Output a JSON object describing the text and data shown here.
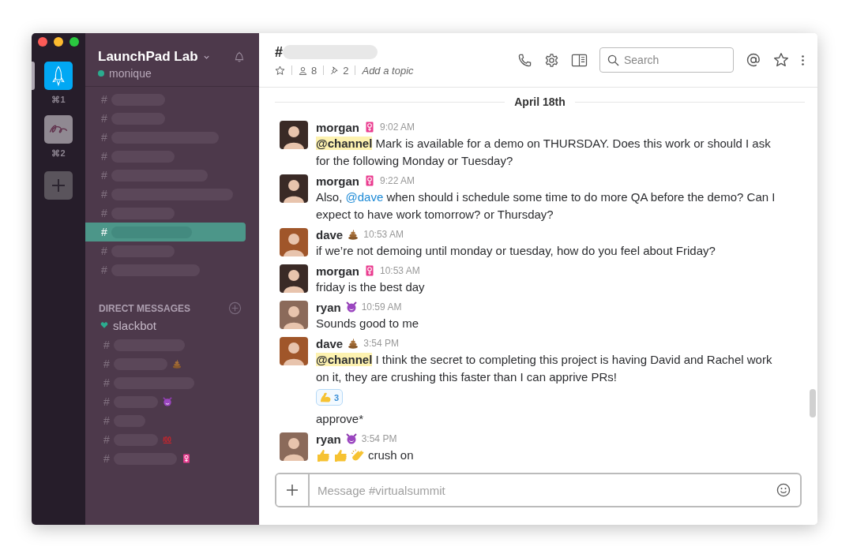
{
  "teams": [
    {
      "kind": "rocket",
      "shortcut": "⌘1",
      "selected": true
    },
    {
      "kind": "sass",
      "shortcut": "⌘2",
      "selected": false
    }
  ],
  "sidebar": {
    "team_name": "LaunchPad Lab",
    "user": "monique",
    "channels": [
      {
        "prefix": "#",
        "selected": false
      },
      {
        "prefix": "#",
        "selected": false
      },
      {
        "prefix": "#",
        "selected": false
      },
      {
        "prefix": "#",
        "selected": false
      },
      {
        "prefix": "#",
        "selected": false
      },
      {
        "prefix": "#",
        "selected": false
      },
      {
        "prefix": "#",
        "selected": false
      },
      {
        "prefix": "#",
        "selected": true
      },
      {
        "prefix": "#",
        "selected": false
      },
      {
        "prefix": "#",
        "selected": false
      }
    ],
    "direct_messages_heading": "DIRECT MESSAGES",
    "direct_messages": [
      {
        "kind": "bot",
        "name": "slackbot"
      },
      {
        "kind": "redacted",
        "prefix": "#"
      },
      {
        "kind": "redacted",
        "prefix": "#",
        "status": {
          "kind": "poop"
        }
      },
      {
        "kind": "redacted",
        "prefix": "#"
      },
      {
        "kind": "redacted",
        "prefix": "#",
        "status": {
          "kind": "devil"
        }
      },
      {
        "kind": "redacted",
        "prefix": "#"
      },
      {
        "kind": "redacted",
        "prefix": "#",
        "status": {
          "kind": "hundred"
        }
      },
      {
        "kind": "redacted",
        "prefix": "#",
        "status": {
          "kind": "female-sign"
        }
      }
    ]
  },
  "channel_header": {
    "prefix": "#",
    "members": "8",
    "pins": "2",
    "topic_placeholder": "Add a topic"
  },
  "search": {
    "placeholder": "Search"
  },
  "date_divider": "April 18th",
  "messages": [
    {
      "author": "morgan",
      "status": {
        "kind": "female-sign"
      },
      "time": "9:02 AM",
      "color": "#3a2a26",
      "parts": [
        {
          "kind": "channel",
          "text": "@channel"
        },
        {
          "kind": "text",
          "text": " Mark is available for a demo on THURSDAY. Does this work or should I ask for the following Monday or Tuesday?"
        }
      ]
    },
    {
      "author": "morgan",
      "status": {
        "kind": "female-sign"
      },
      "time": "9:22 AM",
      "color": "#3a2a26",
      "parts": [
        {
          "kind": "text",
          "text": "Also, "
        },
        {
          "kind": "user",
          "text": "@dave"
        },
        {
          "kind": "text",
          "text": " when should i schedule some time to do more QA before the demo? Can I expect to have work tomorrow? or Thursday?"
        }
      ]
    },
    {
      "author": "dave",
      "status": {
        "kind": "poop"
      },
      "time": "10:53 AM",
      "color": "#a0562a",
      "parts": [
        {
          "kind": "text",
          "text": "if we’re not demoing until monday or tuesday, how do you feel about Friday?"
        }
      ]
    },
    {
      "author": "morgan",
      "status": {
        "kind": "female-sign"
      },
      "time": "10:53 AM",
      "color": "#3a2a26",
      "parts": [
        {
          "kind": "text",
          "text": "friday is the best day"
        }
      ]
    },
    {
      "author": "ryan",
      "status": {
        "kind": "devil"
      },
      "time": "10:59 AM",
      "color": "#8b6a5a",
      "parts": [
        {
          "kind": "text",
          "text": "Sounds good to me"
        }
      ]
    },
    {
      "author": "dave",
      "status": {
        "kind": "poop"
      },
      "time": "3:54 PM",
      "color": "#a0562a",
      "parts": [
        {
          "kind": "channel",
          "text": "@channel"
        },
        {
          "kind": "text",
          "text": " I think the secret to completing this project is having David and Rachel work on it, they are crushing this faster than I can apprive PRs!"
        }
      ],
      "reaction": {
        "kind": "muscle",
        "count": "3"
      },
      "followup": "approve*"
    },
    {
      "author": "ryan",
      "status": {
        "kind": "devil"
      },
      "time": "3:54 PM",
      "color": "#8b6a5a",
      "lead_emojis": [
        {
          "kind": "thumbs-up"
        },
        {
          "kind": "thumbs-up"
        },
        {
          "kind": "clap"
        }
      ],
      "parts": [
        {
          "kind": "text",
          "text": "crush on"
        }
      ]
    }
  ],
  "composer": {
    "placeholder": "Message #virtualsummit"
  }
}
